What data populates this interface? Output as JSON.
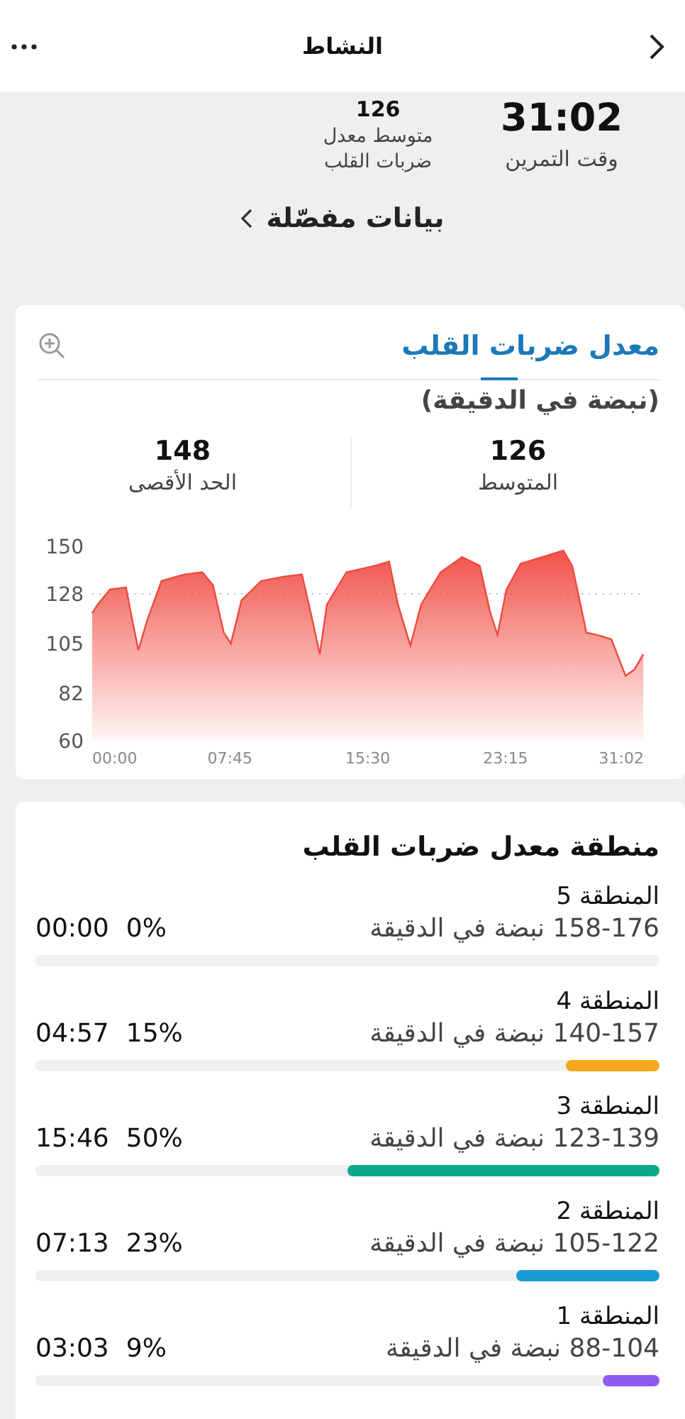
{
  "header": {
    "title": "النشاط"
  },
  "summary": {
    "stats": [
      {
        "value": "31:02",
        "label": "وقت التمرين"
      },
      {
        "value": "126",
        "label": "متوسط معدل ضربات القلب"
      }
    ],
    "details_link": "بيانات مفصّلة"
  },
  "heart_rate": {
    "title": "معدل ضربات القلب",
    "unit": "(نبضة في الدقيقة)",
    "stats": [
      {
        "value": "126",
        "label": "المتوسط"
      },
      {
        "value": "148",
        "label": "الحد الأقصى"
      }
    ],
    "chart_data": {
      "type": "area",
      "x": [
        0,
        0.3,
        1.0,
        1.9,
        2.3,
        2.6,
        3.1,
        3.9,
        5.2,
        6.2,
        6.8,
        7.4,
        7.8,
        8.4,
        9.5,
        10.8,
        11.8,
        12.3,
        12.8,
        13.2,
        14.3,
        15.9,
        16.7,
        17.2,
        17.9,
        18.5,
        19.6,
        20.8,
        21.8,
        22.4,
        22.8,
        23.3,
        24.1,
        25.7,
        26.5,
        27.0,
        27.8,
        28.4,
        29.2,
        30.0,
        30.5,
        31.0
      ],
      "series": [
        {
          "color": "#f0493f",
          "values": [
            119,
            123,
            130,
            131,
            114,
            102,
            116,
            134,
            137,
            138,
            132,
            110,
            105,
            125,
            134,
            136,
            137,
            119,
            100,
            123,
            138,
            141,
            143,
            123,
            104,
            123,
            138,
            145,
            141,
            119,
            109,
            130,
            142,
            146,
            148,
            141,
            110,
            109,
            107,
            90,
            93,
            100
          ]
        }
      ],
      "xlim": [
        0,
        31.03
      ],
      "ylim": [
        60,
        150
      ],
      "yticks": [
        60,
        82,
        105,
        128,
        150
      ],
      "xticks": [
        {
          "value": 0,
          "label": "00:00"
        },
        {
          "value": 7.75,
          "label": "07:45"
        },
        {
          "value": 15.5,
          "label": "15:30"
        },
        {
          "value": 23.25,
          "label": "23:15"
        },
        {
          "value": 31.03,
          "label": "31:02"
        }
      ]
    }
  },
  "zones_card": {
    "title": "منطقة معدل ضربات القلب",
    "zones": [
      {
        "name": "المنطقة 5",
        "range": "158-176 نبضة في الدقيقة",
        "percent": "0%",
        "time": "00:00"
      },
      {
        "name": "المنطقة 4",
        "range": "140-157 نبضة في الدقيقة",
        "percent": "15%",
        "time": "04:57",
        "level": 0.15,
        "color": "#f6a81c"
      },
      {
        "name": "المنطقة 3",
        "range": "123-139 نبضة في الدقيقة",
        "percent": "50%",
        "time": "15:46",
        "level": 0.5,
        "color": "#0aa988"
      },
      {
        "name": "المنطقة 2",
        "range": "105-122 نبضة في الدقيقة",
        "percent": "23%",
        "time": "07:13",
        "level": 0.23,
        "color": "#1b9bd6"
      },
      {
        "name": "المنطقة 1",
        "range": "88-104 نبضة في الدقيقة",
        "percent": "9%",
        "time": "03:03",
        "level": 0.09,
        "color": "#8f5cf2"
      }
    ]
  }
}
